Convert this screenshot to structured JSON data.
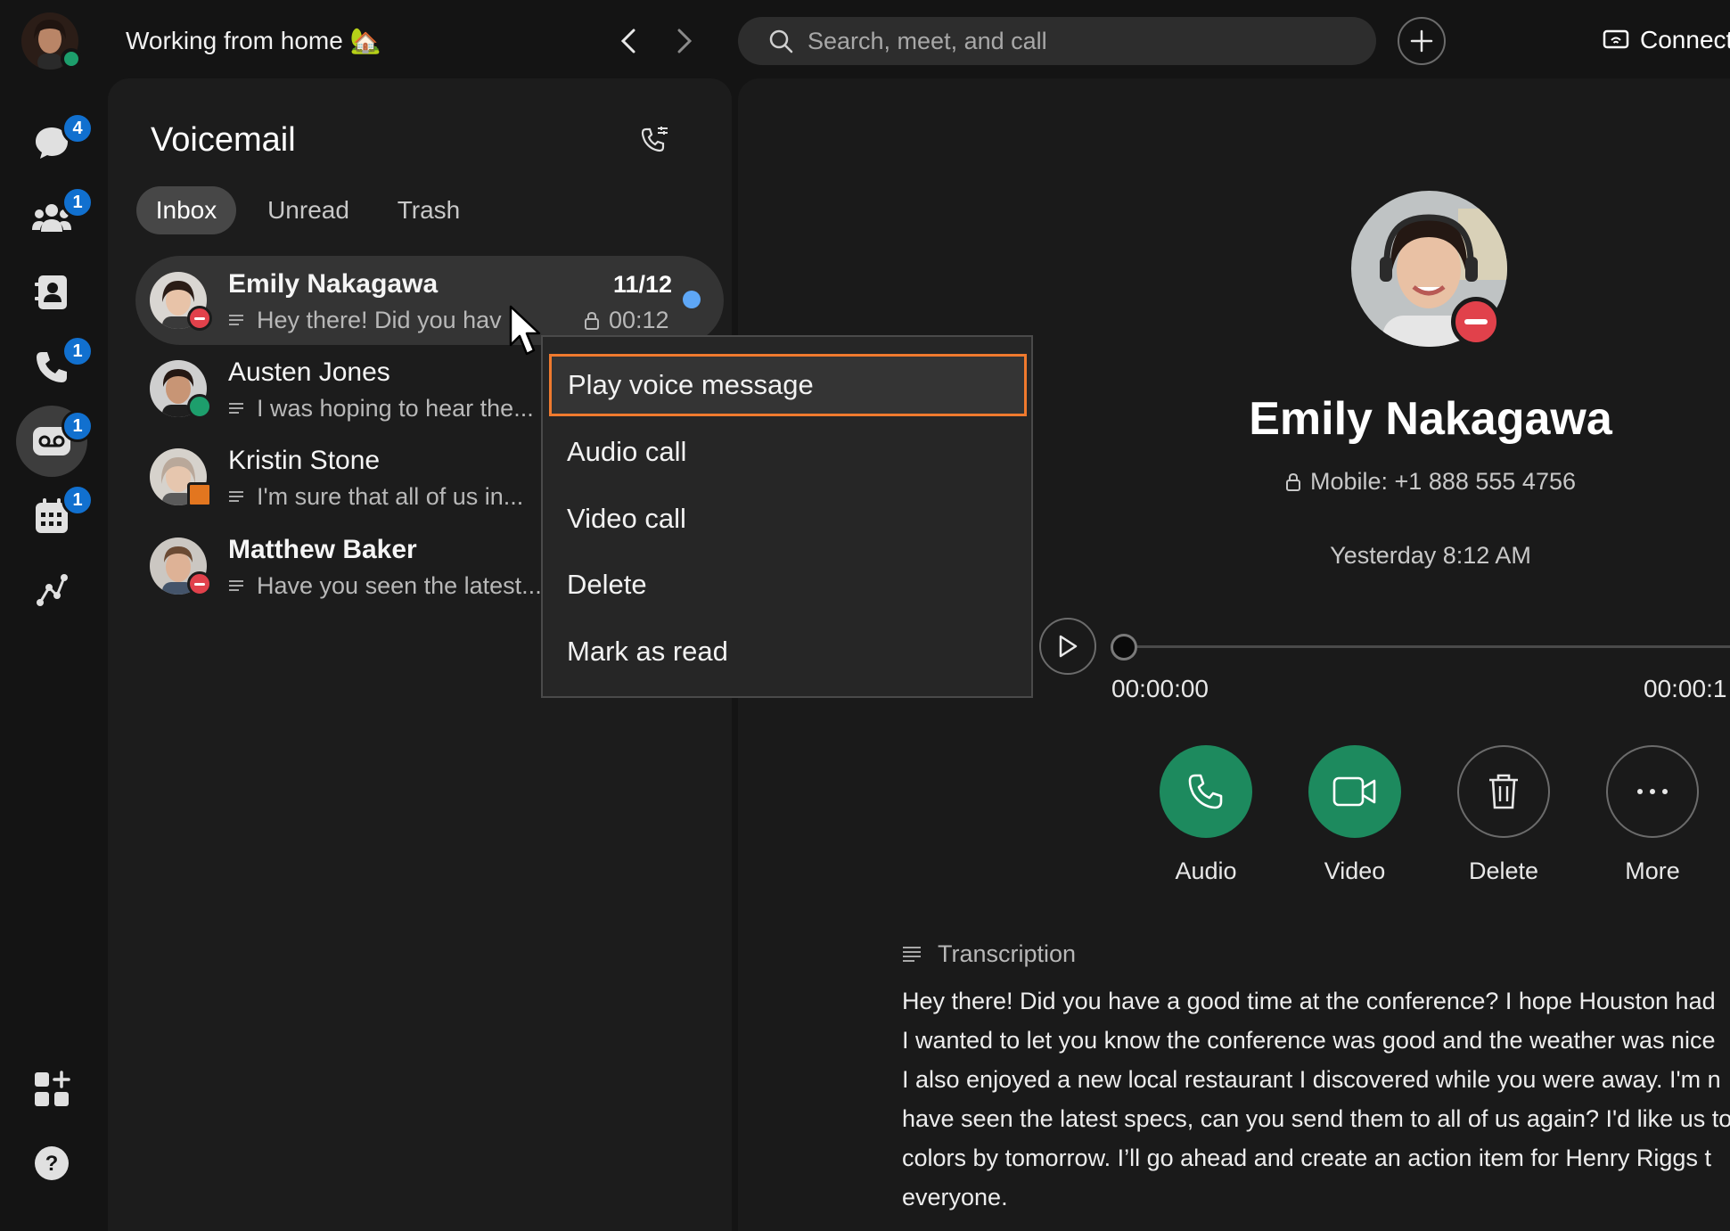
{
  "header": {
    "status_text": "Working from home 🏡",
    "search_placeholder": "Search, meet, and call",
    "connect_label": "Connect"
  },
  "rail": {
    "messaging_badge": "4",
    "teams_badge": "1",
    "calling_badge": "1",
    "voicemail_badge": "1",
    "calendar_badge": "1"
  },
  "voicemail": {
    "title": "Voicemail",
    "tabs": [
      "Inbox",
      "Unread",
      "Trash"
    ],
    "items": [
      {
        "name": "Emily Nakagawa",
        "preview": "Hey there! Did you hav",
        "date": "11/12",
        "duration": "00:12",
        "unread": true
      },
      {
        "name": "Austen Jones",
        "preview": "I was hoping to hear the..."
      },
      {
        "name": "Kristin Stone",
        "preview": "I'm sure that all of us in..."
      },
      {
        "name": "Matthew Baker",
        "preview": "Have you seen the latest..."
      }
    ]
  },
  "context_menu": {
    "items": [
      "Play voice message",
      "Audio call",
      "Video call",
      "Delete",
      "Mark as read"
    ]
  },
  "detail": {
    "name": "Emily Nakagawa",
    "mobile": "Mobile: +1 888 555 4756",
    "time": "Yesterday 8:12 AM",
    "elapsed": "00:00:00",
    "total": "00:00:1",
    "actions": [
      "Audio",
      "Video",
      "Delete",
      "More"
    ],
    "transcription_label": "Transcription",
    "transcription_lines": [
      "Hey there! Did you have a good time at the conference? I hope Houston had",
      "I wanted to let you know the conference was good and the weather was nice",
      "I also enjoyed a new local restaurant I discovered while you were away. I'm n",
      "have seen the latest specs, can you send them to all of us again? I'd like us to",
      "colors by tomorrow. I’ll go ahead and create an action item for Henry Riggs t",
      "everyone."
    ]
  },
  "colors": {
    "accent_green": "#1d8a5e",
    "badge_blue": "#1170cf",
    "focus_orange": "#f07a2e",
    "dnd_red": "#e1414b"
  }
}
